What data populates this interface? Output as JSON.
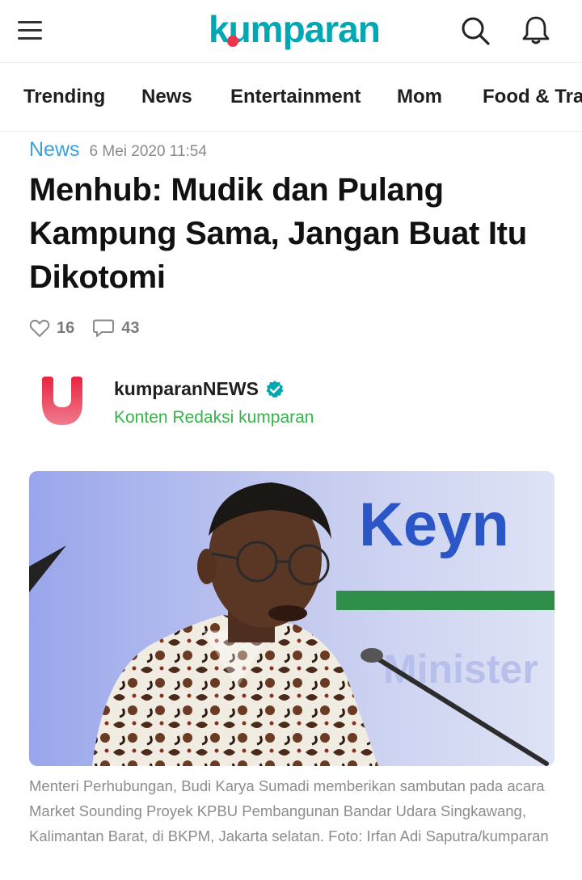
{
  "header": {
    "logo_text": "kumparan",
    "icons": {
      "menu": "menu-icon",
      "search": "search-icon",
      "notifications": "bell-icon"
    },
    "colors": {
      "brand": "#00a8b3",
      "accent": "#e8364f"
    }
  },
  "categories": [
    "Trending",
    "News",
    "Entertainment",
    "Mom",
    "Food & Travel"
  ],
  "article": {
    "section": "News",
    "date": "6 Mei 2020 11:54",
    "title": "Menhub: Mudik dan Pulang Kampung Sama, Jangan Buat Itu Dikotomi",
    "likes": "16",
    "comments": "43",
    "author": {
      "name": "kumparanNEWS",
      "verified": true,
      "subtitle": "Konten Redaksi kumparan"
    },
    "photo": {
      "sign_text_1": "Keyn",
      "sign_text_2": "Minister"
    },
    "caption": "Menteri Perhubungan, Budi Karya Sumadi memberikan sambutan pada acara Market Sounding Proyek KPBU Pembangunan Bandar Udara Singkawang, Kalimantan Barat, di BKPM, Jakarta selatan. Foto: Irfan Adi Saputra/kumparan"
  }
}
